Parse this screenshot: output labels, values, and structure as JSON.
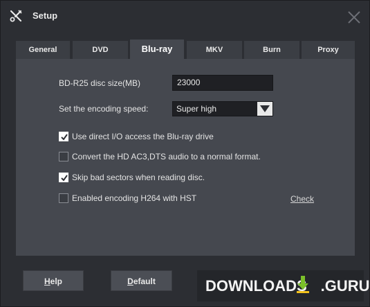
{
  "window": {
    "title": "Setup",
    "icons": {
      "app": "tools-icon",
      "close": "close-icon"
    }
  },
  "tabs": [
    {
      "label": "General",
      "active": false
    },
    {
      "label": "DVD",
      "active": false
    },
    {
      "label": "Blu-ray",
      "active": true
    },
    {
      "label": "MKV",
      "active": false
    },
    {
      "label": "Burn",
      "active": false
    },
    {
      "label": "Proxy",
      "active": false
    }
  ],
  "bluray": {
    "disc_size_label": "BD-R25 disc size(MB)",
    "disc_size_value": "23000",
    "encoding_speed_label": "Set the encoding speed:",
    "encoding_speed_value": "Super high",
    "options": [
      {
        "label": "Use direct I/O access the Blu-ray drive",
        "checked": true
      },
      {
        "label": "Convert the HD AC3,DTS audio to a normal format.",
        "checked": false
      },
      {
        "label": "Skip bad sectors when reading disc.",
        "checked": true
      },
      {
        "label": "Enabled encoding H264 with HST",
        "checked": false
      }
    ],
    "check_link": "Check"
  },
  "buttons": {
    "help": {
      "pre": "",
      "u": "H",
      "post": "elp"
    },
    "default": {
      "pre": "",
      "u": "D",
      "post": "efault"
    }
  },
  "watermark": {
    "left": "DOWNLOADS",
    "right": ".GURU"
  },
  "colors": {
    "background": "#2c2e33",
    "panel": "#45484f",
    "tab": "#3b3e44",
    "input": "#1f2024",
    "watermark_accent": "#7bbf2a"
  }
}
